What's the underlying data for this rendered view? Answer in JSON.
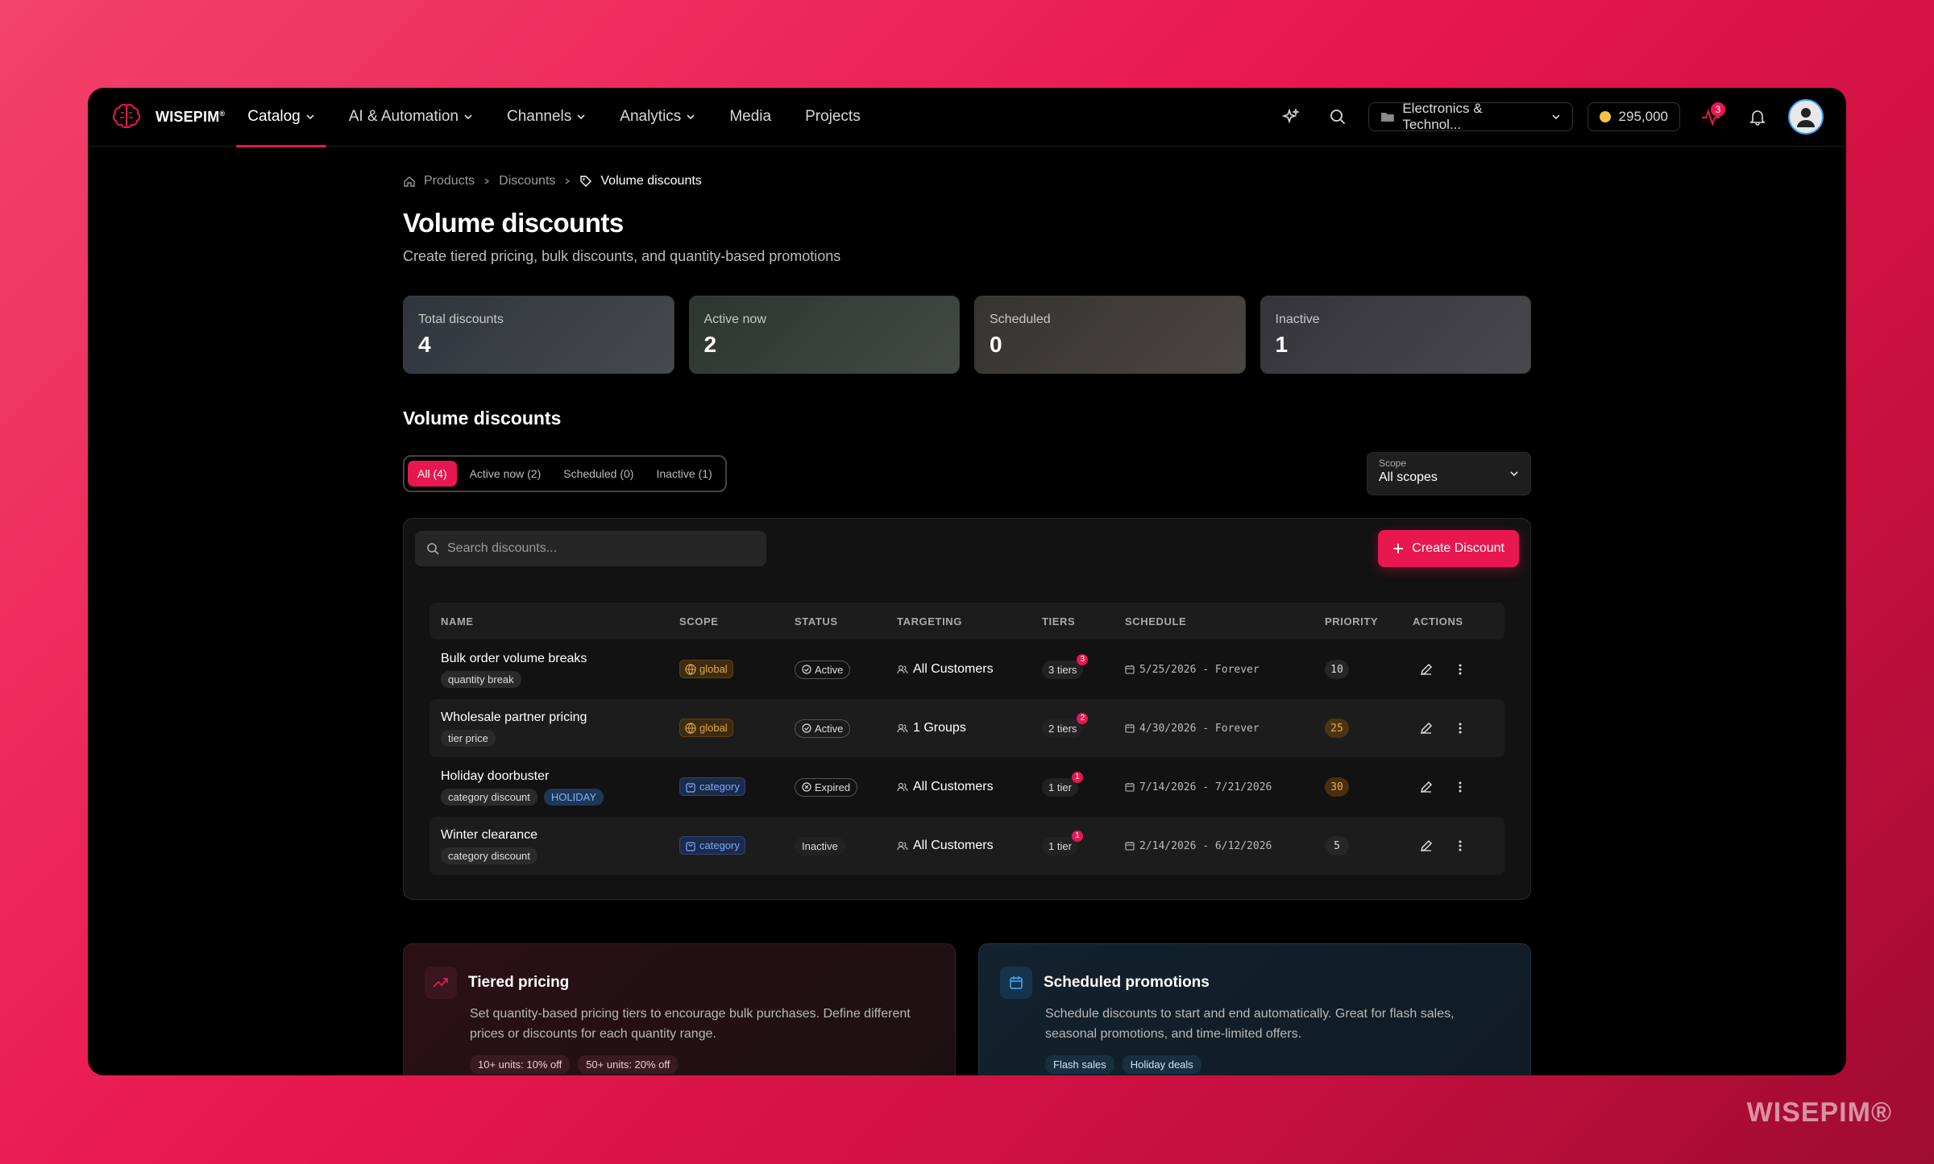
{
  "brand": {
    "name": "WISEPIM",
    "mark": "®"
  },
  "nav": {
    "items": [
      {
        "label": "Catalog",
        "has_menu": true,
        "active": true
      },
      {
        "label": "AI & Automation",
        "has_menu": true
      },
      {
        "label": "Channels",
        "has_menu": true
      },
      {
        "label": "Analytics",
        "has_menu": true
      },
      {
        "label": "Media",
        "has_menu": false
      },
      {
        "label": "Projects",
        "has_menu": false
      }
    ],
    "workspace": "Electronics & Technol...",
    "credits": "295,000",
    "activity_badge": "3"
  },
  "breadcrumb": {
    "items": [
      "Products",
      "Discounts"
    ],
    "current": "Volume discounts"
  },
  "page": {
    "title": "Volume discounts",
    "subtitle": "Create tiered pricing, bulk discounts, and quantity-based promotions"
  },
  "stats": [
    {
      "label": "Total discounts",
      "value": "4"
    },
    {
      "label": "Active now",
      "value": "2"
    },
    {
      "label": "Scheduled",
      "value": "0"
    },
    {
      "label": "Inactive",
      "value": "1"
    }
  ],
  "section": {
    "title": "Volume discounts"
  },
  "filters": {
    "tabs": [
      "All (4)",
      "Active now (2)",
      "Scheduled (0)",
      "Inactive (1)"
    ],
    "active_tab": 0,
    "scope_label": "Scope",
    "scope_value": "All scopes"
  },
  "toolbar": {
    "search_placeholder": "Search discounts...",
    "create_label": "Create Discount"
  },
  "table": {
    "headers": [
      "NAME",
      "SCOPE",
      "STATUS",
      "TARGETING",
      "TIERS",
      "SCHEDULE",
      "PRIORITY",
      "ACTIONS"
    ],
    "rows": [
      {
        "name": "Bulk order volume breaks",
        "tags": [
          "quantity break"
        ],
        "scope": "global",
        "status": "Active",
        "targeting": "All Customers",
        "tiers": "3 tiers",
        "tier_count": "3",
        "schedule": "5/25/2026 - Forever",
        "priority": "10"
      },
      {
        "name": "Wholesale partner pricing",
        "tags": [
          "tier price"
        ],
        "scope": "global",
        "status": "Active",
        "targeting": "1 Groups",
        "tiers": "2 tiers",
        "tier_count": "2",
        "schedule": "4/30/2026 - Forever",
        "priority": "25"
      },
      {
        "name": "Holiday doorbuster",
        "tags": [
          "category discount",
          "HOLIDAY"
        ],
        "scope": "category",
        "status": "Expired",
        "targeting": "All Customers",
        "tiers": "1 tier",
        "tier_count": "1",
        "schedule": "7/14/2026 - 7/21/2026",
        "priority": "30"
      },
      {
        "name": "Winter clearance",
        "tags": [
          "category discount"
        ],
        "scope": "category",
        "status": "Inactive",
        "targeting": "All Customers",
        "tiers": "1 tier",
        "tier_count": "1",
        "schedule": "2/14/2026 - 6/12/2026",
        "priority": "5"
      }
    ]
  },
  "info_cards": [
    {
      "title": "Tiered pricing",
      "description": "Set quantity-based pricing tiers to encourage bulk purchases. Define different prices or discounts for each quantity range.",
      "tags": [
        "10+ units: 10% off",
        "50+ units: 20% off"
      ]
    },
    {
      "title": "Scheduled promotions",
      "description": "Schedule discounts to start and end automatically. Great for flash sales, seasonal promotions, and time-limited offers.",
      "tags": [
        "Flash sales",
        "Holiday deals"
      ]
    }
  ],
  "watermark": "WISEPIM®",
  "colors": {
    "accent": "#e8174f",
    "background": "#000000"
  }
}
